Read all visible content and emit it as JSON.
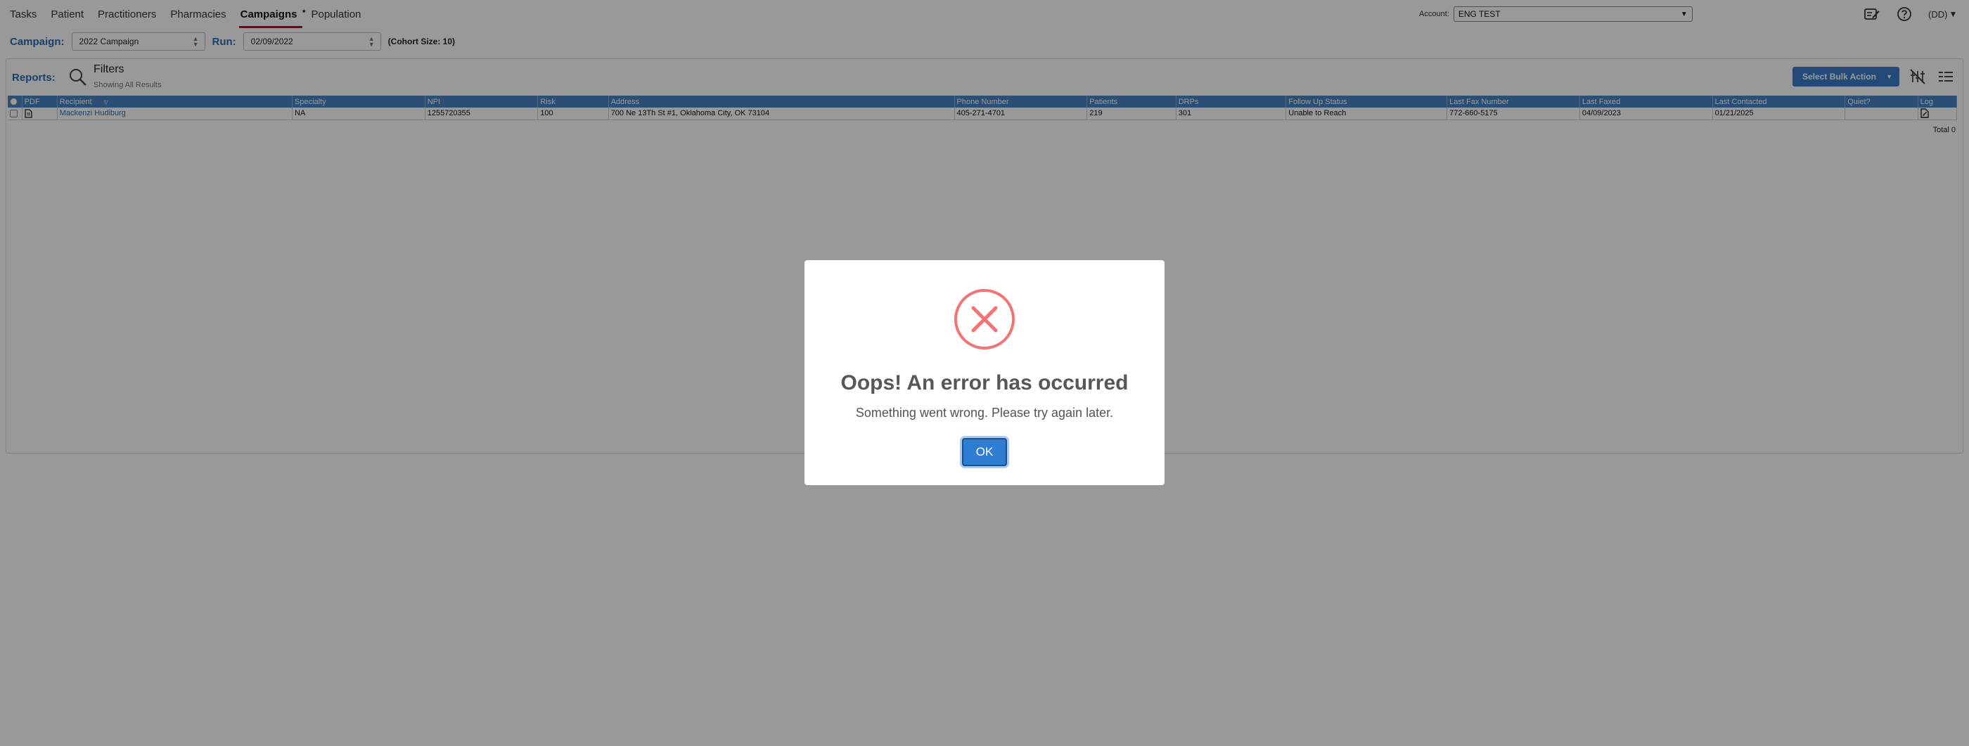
{
  "nav": {
    "tabs": [
      {
        "label": "Tasks"
      },
      {
        "label": "Patient"
      },
      {
        "label": "Practitioners"
      },
      {
        "label": "Pharmacies"
      },
      {
        "label": "Campaigns",
        "active": true,
        "marker": "*"
      },
      {
        "label": "Population"
      }
    ],
    "account_label": "Account:",
    "account_value": "ENG TEST",
    "user_label": "(DD)"
  },
  "campaign_bar": {
    "campaign_label": "Campaign:",
    "campaign_value": "2022 Campaign",
    "run_label": "Run:",
    "run_value": "02/09/2022",
    "cohort_text": "(Cohort Size: 10)"
  },
  "reports": {
    "label": "Reports:",
    "filters_title": "Filters",
    "filters_subtitle": "Showing All Results",
    "bulk_action_label": "Select Bulk Action",
    "total_text": "Total 0",
    "columns": [
      "PDF",
      "Recipient",
      "Specialty",
      "NPI",
      "Risk",
      "Address",
      "Phone Number",
      "Patients",
      "DRPs",
      "Follow Up Status",
      "Last Fax Number",
      "Last Faxed",
      "Last Contacted",
      "Quiet?",
      "Log"
    ],
    "rows": [
      {
        "recipient": "Mackenzi Hudiburg",
        "specialty": "NA",
        "npi": "1255720355",
        "risk": "100",
        "address": "700 Ne 13Th St #1, Oklahoma City, OK 73104",
        "phone": "405-271-4701",
        "patients": "219",
        "drps": "301",
        "follow_up_status": "Unable to Reach",
        "last_fax_number": "772-660-5175",
        "last_faxed": "04/09/2023",
        "last_contacted": "01/21/2025",
        "quiet": ""
      }
    ]
  },
  "modal": {
    "icon": "error-x-icon",
    "title": "Oops! An error has occurred",
    "message": "Something went wrong. Please try again later.",
    "ok_label": "OK"
  },
  "colors": {
    "accent_blue": "#2c6db3",
    "header_blue": "#4682c2",
    "active_underline": "#d0021b",
    "error_red": "#f27474",
    "ok_button": "#2f7dd3"
  }
}
